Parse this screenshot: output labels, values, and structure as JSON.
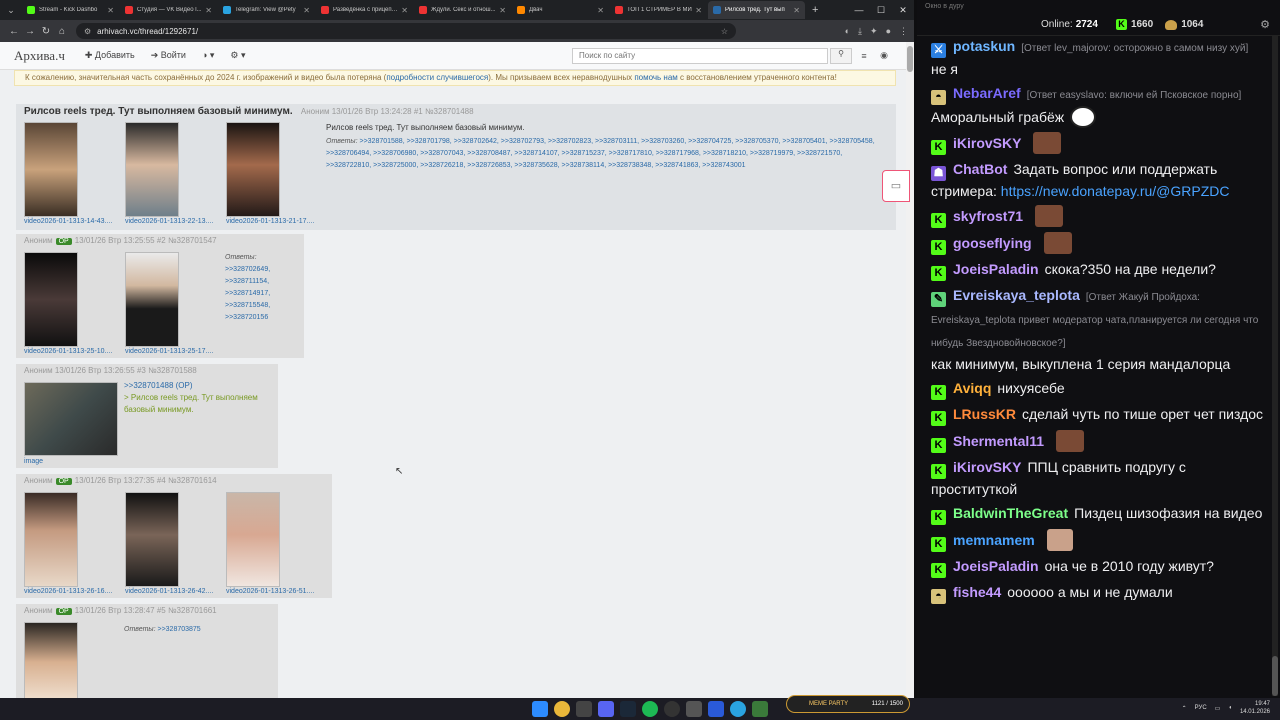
{
  "browser": {
    "tabs": [
      {
        "title": "Stream - Kick Dashbo",
        "color": "#53fc18"
      },
      {
        "title": "Студия — VK Видео l...",
        "color": "#e33"
      },
      {
        "title": "Telegram: View @Pety",
        "color": "#2aa3e0"
      },
      {
        "title": "Разведёнка с прицепо...",
        "color": "#e33"
      },
      {
        "title": "Ждули. Секс и отнош...",
        "color": "#e33"
      },
      {
        "title": "Двач",
        "color": "#f80"
      },
      {
        "title": "ТОП 1 СТРИМЕР В МИ",
        "color": "#e33"
      },
      {
        "title": "Рилсов тред. Тут вып",
        "color": "#2a6aa8",
        "active": true
      }
    ],
    "url": "arhivach.vc/thread/1292671/"
  },
  "site": {
    "logo": "Архива.ч",
    "nav": {
      "add": "Добавить",
      "login": "Войти"
    },
    "search_placeholder": "Поиск по сайту",
    "notice": {
      "text1": "К сожалению, значительная часть сохранённых до 2024 г. изображений и видео была потеряна (",
      "link1": "подробности случившегося",
      "text2": "). Мы призываем всех неравнодушных ",
      "link2": "помочь нам",
      "text3": " с восстановлением утраченного контента!"
    },
    "posts": [
      {
        "title": "Рилсов reels тред. Тут выполняем базовый минимум.",
        "meta": "Аноним  13/01/26 Втр 13:24:28  #1  №328701488",
        "files": [
          "video2026-01-1313-14-43....",
          "video2026-01-1313-22-13....",
          "video2026-01-1313-21-17...."
        ],
        "text": "Рилсов reels тред. Тут выполняем базовый минимум.",
        "replies_label": "Ответы:",
        "replies": ">>328701588, >>328701798, >>328702642, >>328702793, >>328702823, >>328703111, >>328703260, >>328704725, >>328705370, >>328705401, >>328705458, >>328706494, >>328706980, >>328707043, >>328708487, >>328714107, >>328715237, >>328717810, >>328717968, >>328718210, >>328719979, >>328721570, >>328722810, >>328725000, >>328726218, >>328726853, >>328735628, >>328738114, >>328738348, >>328741863, >>328743001"
      },
      {
        "name": "Аноним",
        "op": "OP",
        "meta": "13/01/26 Втр 13:25:55  #2  №328701547",
        "files": [
          "video2026-01-1313-25-10....",
          "video2026-01-1313-25-17...."
        ],
        "replies_label": "Ответы:",
        "replies": [
          ">>328702649,",
          ">>328711154,",
          ">>328714917,",
          ">>328715548,",
          ">>328720156"
        ]
      },
      {
        "meta": "Аноним  13/01/26 Втр 13:26:55  #3  №328701588",
        "files": [
          "image"
        ],
        "link": ">>328701488 (OP)",
        "quote": "> Рилсов reels тред. Тут выполняем базовый минимум."
      },
      {
        "name": "Аноним",
        "op": "OP",
        "meta": "13/01/26 Втр 13:27:35  #4  №328701614",
        "files": [
          "video2026-01-1313-26-16....",
          "video2026-01-1313-26-42....",
          "video2026-01-1313-26-51...."
        ]
      },
      {
        "name": "Аноним",
        "op": "OP",
        "meta": "13/01/26 Втр 13:28:47  #5  №328701661",
        "replies_label": "Ответы:",
        "replies": ">>328703875"
      }
    ]
  },
  "chat": {
    "title": "Окно в дуру",
    "online_label": "Online:",
    "online": "2724",
    "kick_count": "1660",
    "coin_count": "1064",
    "messages": [
      {
        "user": "potaskun",
        "color": "#6fb6ff",
        "reply": "[Ответ lev_majorov: осторожно в самом низу хуй]",
        "text": "не я",
        "badge": "mod"
      },
      {
        "user": "NebarAref",
        "color": "#7b6bff",
        "reply": "[Ответ easyslavo: включи ей Псковское порно]",
        "text": "Аморальный грабёж",
        "badge": "hat",
        "emote": "mask"
      },
      {
        "user": "iKirovSKY",
        "color": "#c39bff",
        "text": "",
        "badge": "kick",
        "emote": "face"
      },
      {
        "user": "ChatBot",
        "color": "#c39bff",
        "text": "Задать вопрос или поддержать стримера: ",
        "link": "https://new.donatepay.ru/@GRPZDC",
        "badge": "bot"
      },
      {
        "user": "skyfrost71",
        "color": "#c39bff",
        "text": "",
        "badge": "kick",
        "emote": "face"
      },
      {
        "user": "gooseflying",
        "color": "#c39bff",
        "text": "",
        "badge": "kick",
        "emote": "face"
      },
      {
        "user": "JoeisPaladin",
        "color": "#c39bff",
        "text": "скока?350 на две недели?",
        "badge": "kick"
      },
      {
        "user": "Evreiskaya_teplota",
        "color": "#a9b8ff",
        "reply": "[Ответ Жакуй Пройдоха: Evreiskaya_teplota привет модератор чата,планируется ли сегодня что нибудь Звездновойновское?]",
        "text": "как минимум, выкуплена 1 серия мандалорца",
        "badge": "sword"
      },
      {
        "user": "Aviqq",
        "color": "#ffb13b",
        "text": "нихуясебе",
        "badge": "kick"
      },
      {
        "user": "LRussKR",
        "color": "#ff8a3b",
        "text": "сделай чуть по тише орет чет пиздос",
        "badge": "kick"
      },
      {
        "user": "Shermental11",
        "color": "#c39bff",
        "text": "",
        "badge": "kick",
        "emote": "face"
      },
      {
        "user": "iKirovSKY",
        "color": "#c39bff",
        "text": "ППЦ сравнить подругу с проституткой",
        "badge": "kick"
      },
      {
        "user": "BaldwinTheGreat",
        "color": "#7dff8a",
        "text": "Пиздец шизофазия на видео",
        "badge": "kick"
      },
      {
        "user": "memnamem",
        "color": "#4aa3ff",
        "text": "",
        "badge": "kick",
        "emote": "face2"
      },
      {
        "user": "JoeisPaladin",
        "color": "#c39bff",
        "text": "она че в 2010 году живут?",
        "badge": "kick"
      },
      {
        "user": "fishe44",
        "color": "#c39bff",
        "text": "оооооо а мы и не думали",
        "badge": "hat"
      }
    ]
  },
  "taskbar": {
    "meme": "MEME PARTY",
    "meme_value": "1121 / 1500",
    "lang": "РУС",
    "time": "19:47",
    "date": "14.01.2026"
  }
}
